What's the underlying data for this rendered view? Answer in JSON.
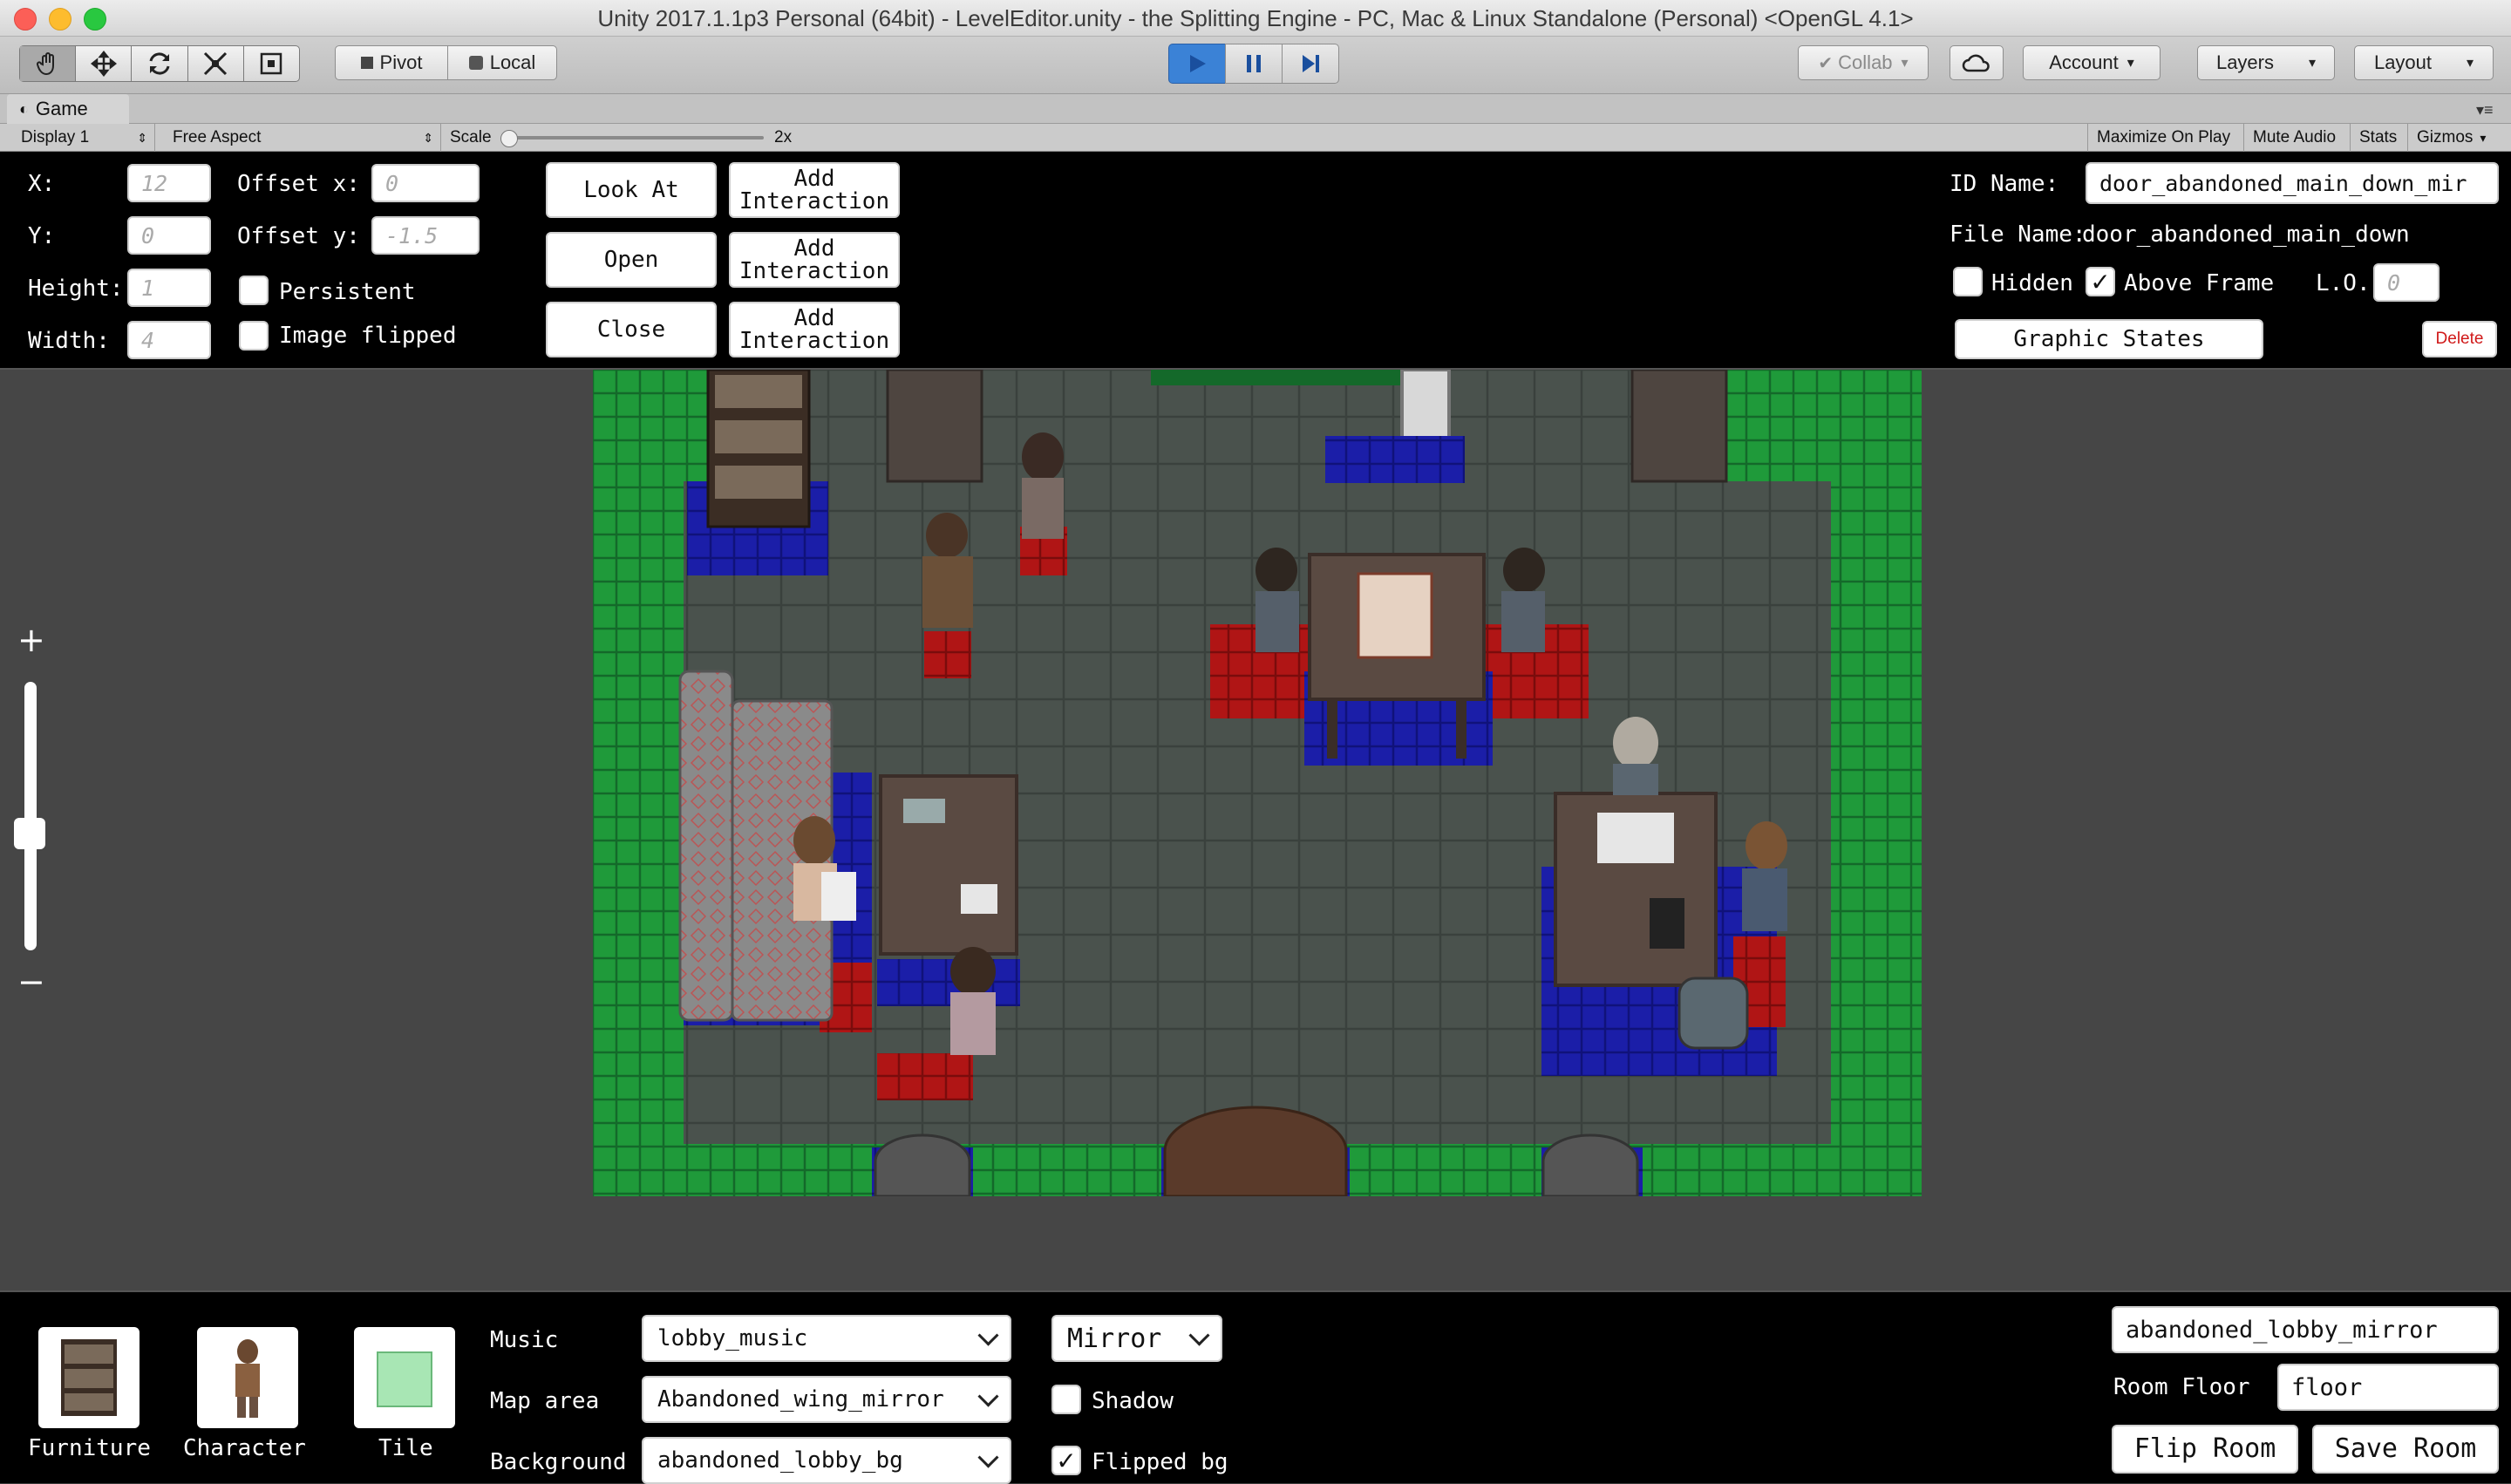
{
  "window": {
    "title": "Unity 2017.1.1p3 Personal (64bit) - LevelEditor.unity - the Splitting Engine - PC, Mac & Linux Standalone (Personal) <OpenGL 4.1>"
  },
  "toolbar": {
    "pivot_label": "Pivot",
    "local_label": "Local",
    "collab_label": "Collab",
    "account_label": "Account",
    "layers_label": "Layers",
    "layout_label": "Layout"
  },
  "game_view": {
    "tab_label": "Game",
    "display_label": "Display 1",
    "aspect_label": "Free Aspect",
    "scale_label": "Scale",
    "scale_value": "2x",
    "maximize_label": "Maximize On Play",
    "mute_label": "Mute Audio",
    "stats_label": "Stats",
    "gizmos_label": "Gizmos"
  },
  "object_panel": {
    "x_label": "X:",
    "x_value": "12",
    "y_label": "Y:",
    "y_value": "0",
    "height_label": "Height:",
    "height_value": "1",
    "width_label": "Width:",
    "width_value": "4",
    "offset_x_label": "Offset x:",
    "offset_x_value": "0",
    "offset_y_label": "Offset y:",
    "offset_y_value": "-1.5",
    "persistent_label": "Persistent",
    "persistent_checked": false,
    "image_flipped_label": "Image flipped",
    "image_flipped_checked": false,
    "interactions": [
      {
        "action": "Look At",
        "add": "Add\nInteraction"
      },
      {
        "action": "Open",
        "add": "Add\nInteraction"
      },
      {
        "action": "Close",
        "add": "Add\nInteraction"
      }
    ],
    "id_name_label": "ID Name:",
    "id_name_value": "door_abandoned_main_down_mir",
    "file_name_label": "File Name:",
    "file_name_value": "door_abandoned_main_down",
    "hidden_label": "Hidden",
    "hidden_checked": false,
    "above_frame_label": "Above Frame",
    "above_frame_checked": true,
    "lo_label": "L.O.",
    "lo_value": "0",
    "graphic_states_label": "Graphic States",
    "delete_label": "Delete"
  },
  "zoom": {
    "plus": "+",
    "minus": "−"
  },
  "bottom_panel": {
    "palette": [
      {
        "label": "Furniture"
      },
      {
        "label": "Character"
      },
      {
        "label": "Tile"
      }
    ],
    "music_label": "Music",
    "music_value": "lobby_music",
    "map_area_label": "Map area",
    "map_area_value": "Abandoned_wing_mirror",
    "background_label": "Background",
    "background_value": "abandoned_lobby_bg",
    "mirror_value": "Mirror",
    "shadow_label": "Shadow",
    "shadow_checked": false,
    "flipped_bg_label": "Flipped bg",
    "flipped_bg_checked": true,
    "room_name_value": "abandoned_lobby_mirror",
    "room_floor_label": "Room Floor",
    "room_floor_value": "floor",
    "flip_room_label": "Flip Room",
    "save_room_label": "Save Room"
  },
  "colors": {
    "play_active": "#3b82d6",
    "wall_green": "#1f9a3a",
    "floor_gray": "#4a524d",
    "tile_blue": "#1b1ea8",
    "tile_red": "#b01515",
    "delete_red": "#d01818"
  }
}
